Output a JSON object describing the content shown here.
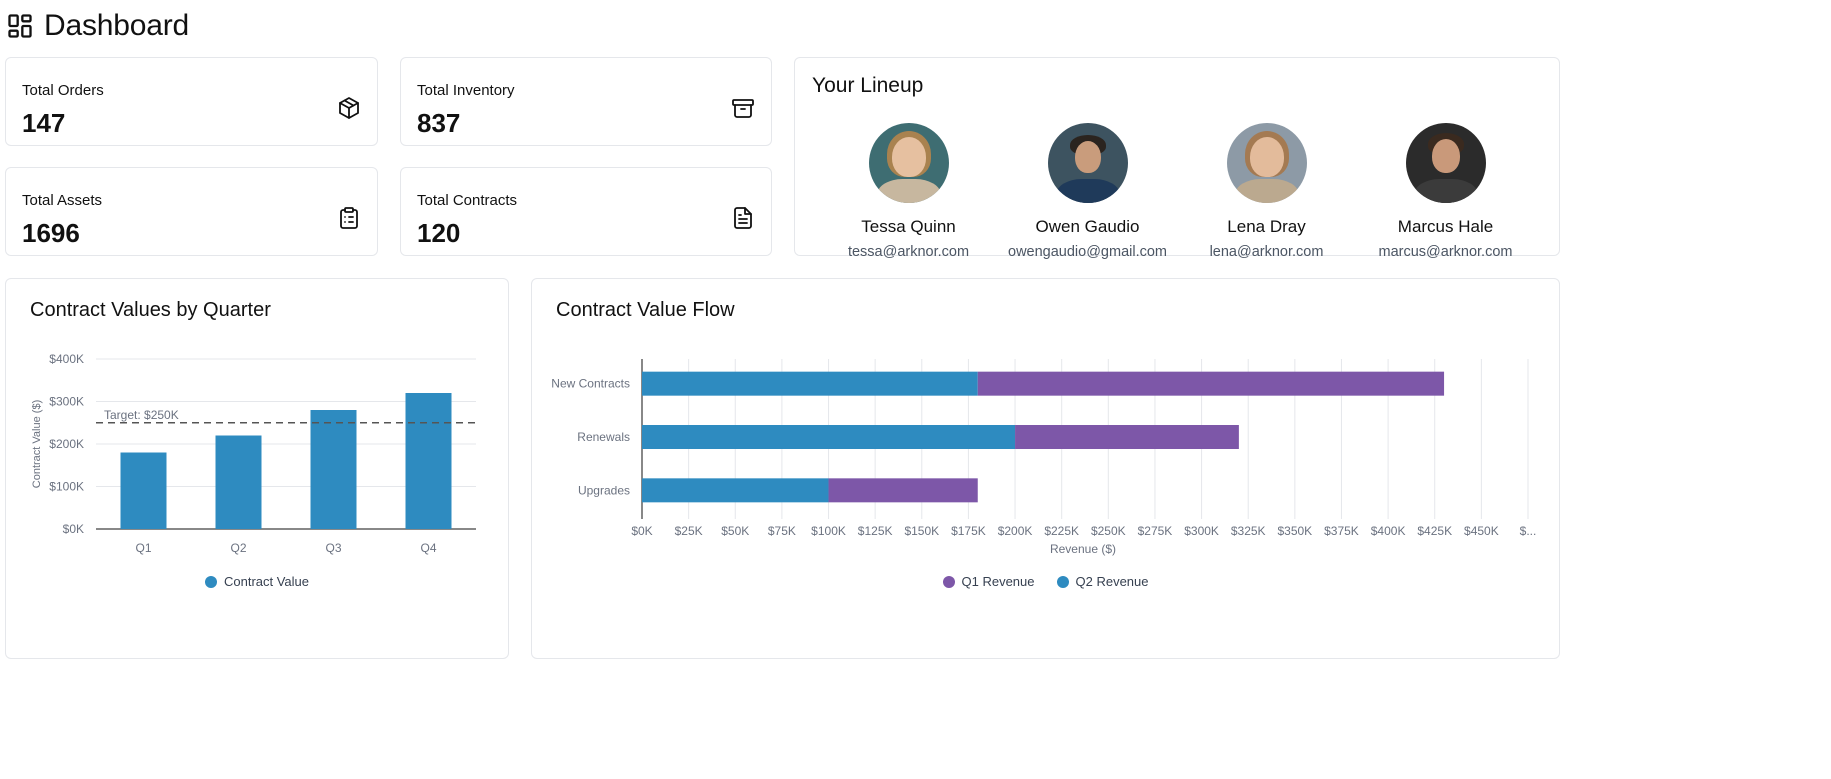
{
  "page": {
    "title": "Dashboard"
  },
  "stats": [
    {
      "label": "Total Orders",
      "value": "147",
      "icon": "package-icon"
    },
    {
      "label": "Total Inventory",
      "value": "837",
      "icon": "archive-icon"
    },
    {
      "label": "Total Assets",
      "value": "1696",
      "icon": "clipboard-icon"
    },
    {
      "label": "Total Contracts",
      "value": "120",
      "icon": "file-text-icon"
    }
  ],
  "lineup": {
    "title": "Your Lineup",
    "people": [
      {
        "name": "Tessa Quinn",
        "email": "tessa@arknor.com"
      },
      {
        "name": "Owen Gaudio",
        "email": "owengaudio@gmail.com"
      },
      {
        "name": "Lena Dray",
        "email": "lena@arknor.com"
      },
      {
        "name": "Marcus Hale",
        "email": "marcus@arknor.com"
      }
    ]
  },
  "colors": {
    "blue": "#2e8bc0",
    "purple": "#7d57a8",
    "border": "#e5e7eb"
  },
  "chart_data": [
    {
      "type": "bar",
      "title": "Contract Values by Quarter",
      "categories": [
        "Q1",
        "Q2",
        "Q3",
        "Q4"
      ],
      "series": [
        {
          "name": "Contract Value",
          "values": [
            180000,
            220000,
            280000,
            320000
          ]
        }
      ],
      "ylabel": "Contract Value ($)",
      "xlabel": "",
      "ylim": [
        0,
        400000
      ],
      "yticks": [
        "$0K",
        "$100K",
        "$200K",
        "$300K",
        "$400K"
      ],
      "reference_line": {
        "label": "Target: $250K",
        "value": 250000
      },
      "grid": true,
      "legend": "bottom"
    },
    {
      "type": "bar",
      "orientation": "horizontal",
      "stacked": true,
      "title": "Contract Value Flow",
      "categories": [
        "New Contracts",
        "Renewals",
        "Upgrades"
      ],
      "series": [
        {
          "name": "Q2 Revenue",
          "values": [
            180000,
            200000,
            100000
          ]
        },
        {
          "name": "Q1 Revenue",
          "values": [
            250000,
            120000,
            80000
          ]
        }
      ],
      "legend_entries": [
        "Q1 Revenue",
        "Q2 Revenue"
      ],
      "xlabel": "Revenue ($)",
      "ylabel": "",
      "xlim": [
        0,
        475000
      ],
      "xticks": [
        "$0K",
        "$25K",
        "$50K",
        "$75K",
        "$100K",
        "$125K",
        "$150K",
        "$175K",
        "$200K",
        "$225K",
        "$250K",
        "$275K",
        "$300K",
        "$325K",
        "$350K",
        "$375K",
        "$400K",
        "$425K",
        "$450K",
        "$..."
      ],
      "grid": true,
      "legend": "bottom"
    }
  ]
}
